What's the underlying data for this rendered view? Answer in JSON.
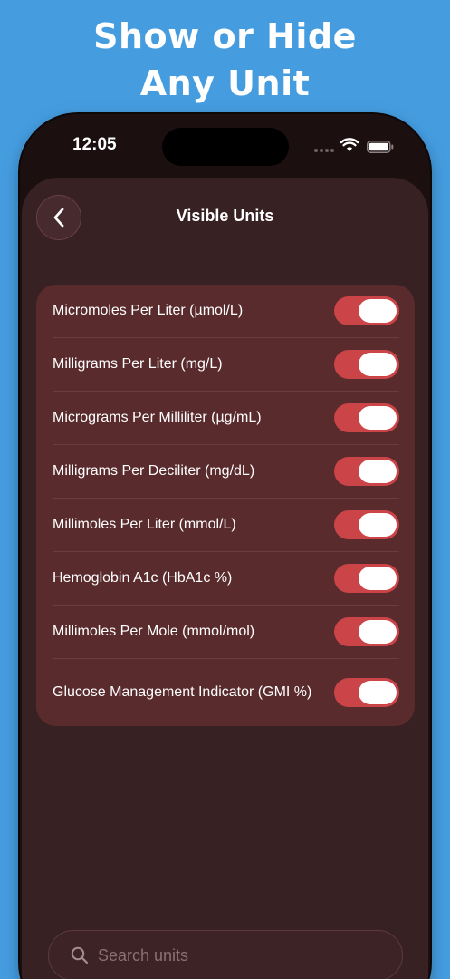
{
  "promo": {
    "headline_line1": "Show or Hide",
    "headline_line2": "Any Unit"
  },
  "status_bar": {
    "time": "12:05"
  },
  "header": {
    "title": "Visible Units",
    "back_icon": "chevron-left-icon"
  },
  "units": [
    {
      "label": "Micromoles Per Liter (µmol/L)",
      "visible": true
    },
    {
      "label": "Milligrams Per Liter (mg/L)",
      "visible": true
    },
    {
      "label": "Micrograms Per Milliliter (µg/mL)",
      "visible": true
    },
    {
      "label": "Milligrams Per Deciliter (mg/dL)",
      "visible": true
    },
    {
      "label": "Millimoles Per Liter (mmol/L)",
      "visible": true
    },
    {
      "label": "Hemoglobin A1c (HbA1c %)",
      "visible": true
    },
    {
      "label": "Millimoles Per Mole (mmol/mol)",
      "visible": true
    },
    {
      "label": "Glucose Management Indicator (GMI %)",
      "visible": true
    }
  ],
  "search": {
    "placeholder": "Search units",
    "icon": "search-icon"
  },
  "colors": {
    "background": "#459de0",
    "sheet": "#372123",
    "card": "#5a2b2d",
    "toggle_on": "#cb4447"
  }
}
